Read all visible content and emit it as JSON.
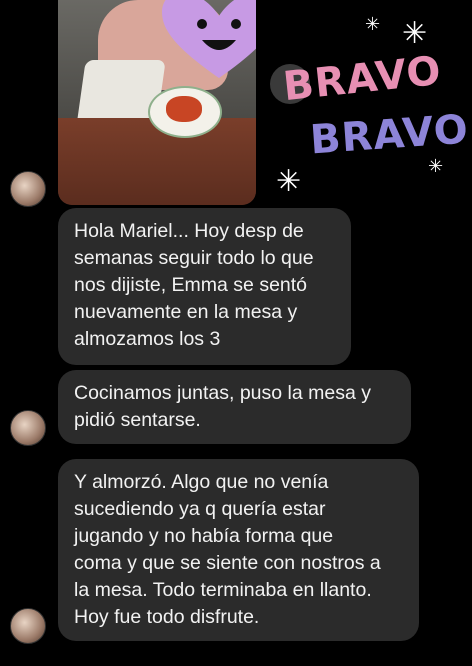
{
  "sticker": {
    "line1": "BRAVO",
    "line2": "BRAVO"
  },
  "messages": [
    {
      "lines": [
        "Hola Mariel... Hoy desp de",
        "semanas seguir todo lo que",
        "nos dijiste, Emma se sentó",
        "nuevamente en la mesa y",
        "almozamos los 3"
      ]
    },
    {
      "lines": [
        "Cocinamos juntas, puso la mesa y",
        "pidió sentarse."
      ]
    },
    {
      "lines": [
        "Y almorzó. Algo que no venía",
        "sucediendo ya q quería estar",
        "jugando y no había forma que",
        "coma y que se siente con nostros a",
        "la mesa. Todo terminaba en llanto.",
        "Hoy fue todo disfrute."
      ]
    }
  ],
  "colors": {
    "bubble": "#2b2b2b",
    "bravo_pink": "#e78fb3",
    "bravo_purple": "#8d84d8"
  }
}
